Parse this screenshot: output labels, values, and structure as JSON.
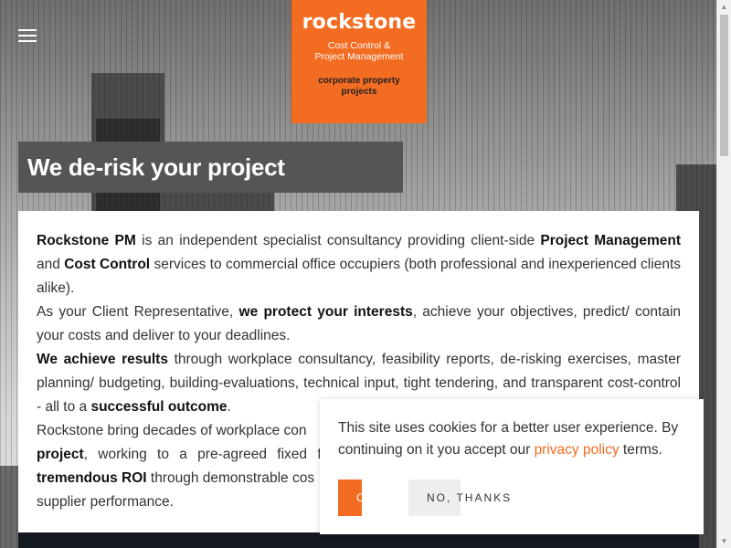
{
  "logo": {
    "name": "rockstone",
    "subtitle_line1": "Cost Control &",
    "subtitle_line2": "Project Management",
    "tagline_line1": "corporate property",
    "tagline_line2": "projects"
  },
  "menu": {
    "icon": "hamburger-icon"
  },
  "headline": "We de-risk your project",
  "content": {
    "p1": {
      "b1": "Rockstone PM",
      "t1": " is an independent specialist consultancy providing client-side ",
      "b2": "Project Management",
      "t2": " and ",
      "b3": "Cost Control",
      "t3": " services to commercial office occupiers (both professional and inexperienced clients alike)."
    },
    "p2": {
      "t1": "As your Client Representative, ",
      "b1": "we protect your interests",
      "t2": ", achieve your objectives, predict/ contain your costs and deliver to your deadlines."
    },
    "p3": {
      "b1": "We achieve results",
      "t1": " through workplace consultancy, feasibility reports, de-risking exercises, master planning/ budgeting, building-evaluations, technical input, tight tendering, and transparent cost-control - all to a ",
      "b2": "successful outcome",
      "t2": "."
    },
    "p4": {
      "t1": "Rockstone bring decades of workplace con",
      "b1": "project",
      "t2": ", working to a pre-agreed fixed f",
      "b2": "tremendous ROI",
      "t3": " through demonstrable cos",
      "t4": "supplier performance."
    }
  },
  "cookie": {
    "text_before": "This site uses cookies for a better user experience. By continuing on it you accept our ",
    "link": "privacy policy",
    "text_after": " terms.",
    "ok_label": "OK",
    "no_label": "NO, THANKS"
  },
  "colors": {
    "brand_orange": "#f26c21",
    "headline_bg": "#555555"
  }
}
